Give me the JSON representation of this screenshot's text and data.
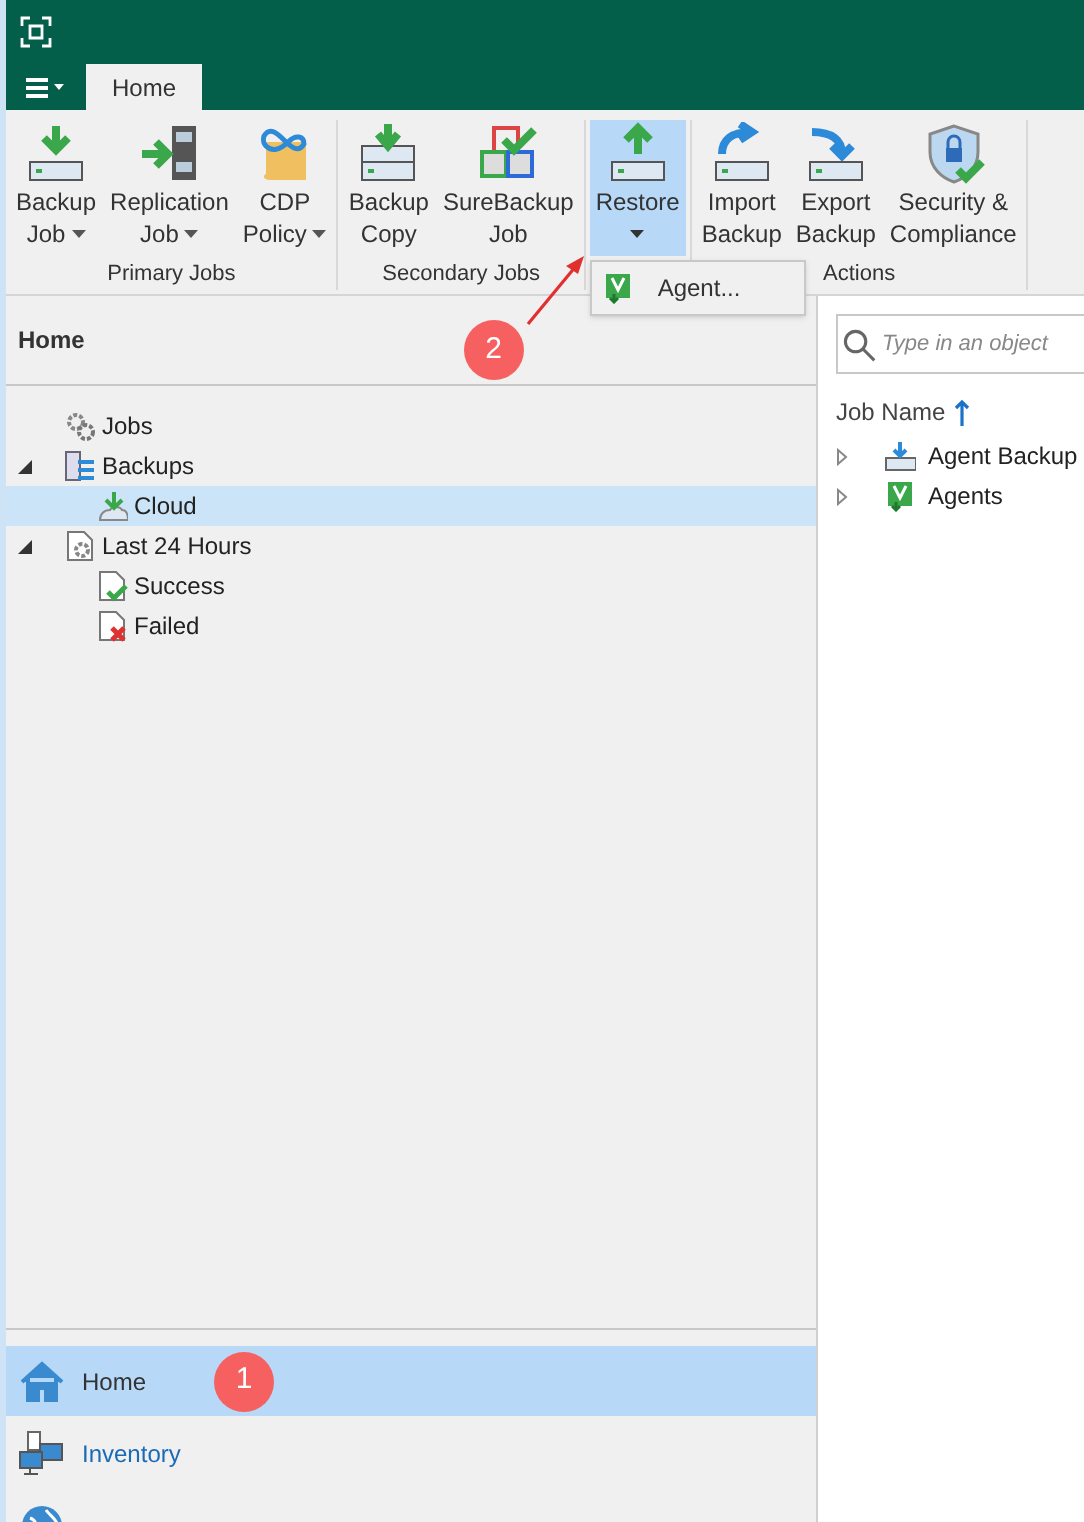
{
  "tabs": [
    {
      "label": "Home",
      "selected": true
    }
  ],
  "ribbon": [
    {
      "label": "Primary Jobs",
      "buttons": [
        {
          "lines": [
            "Backup",
            "Job"
          ],
          "kind": "backup",
          "dropdown": true,
          "selected": false
        },
        {
          "lines": [
            "Replication",
            "Job"
          ],
          "kind": "replication",
          "dropdown": true,
          "selected": false
        },
        {
          "lines": [
            "CDP",
            "Policy"
          ],
          "kind": "cdp",
          "dropdown": true,
          "selected": false
        }
      ]
    },
    {
      "label": "Secondary Jobs",
      "buttons": [
        {
          "lines": [
            "Backup",
            "Copy"
          ],
          "kind": "copy",
          "dropdown": false,
          "selected": false
        },
        {
          "lines": [
            "SureBackup",
            "Job"
          ],
          "kind": "sure",
          "dropdown": false,
          "selected": false
        }
      ]
    },
    {
      "buttons": [
        {
          "lines": [
            "Restore"
          ],
          "kind": "restore",
          "dropdown": true,
          "selected": true,
          "callout": "2",
          "menu": [
            {
              "label": "Agent..."
            }
          ]
        }
      ]
    },
    {
      "label": "Actions",
      "buttons": [
        {
          "lines": [
            "Import",
            "Backup"
          ],
          "kind": "import",
          "dropdown": false,
          "selected": false
        },
        {
          "lines": [
            "Export",
            "Backup"
          ],
          "kind": "export",
          "dropdown": false,
          "selected": false
        },
        {
          "lines": [
            "Security &",
            "Compliance"
          ],
          "kind": "security",
          "dropdown": false,
          "selected": false
        }
      ]
    }
  ],
  "left_panel": {
    "title": "Home",
    "tree": [
      {
        "label": "Jobs",
        "kind": "gears",
        "selected": false
      },
      {
        "label": "Backups",
        "kind": "backups",
        "selected": false,
        "expanded": true,
        "children": [
          {
            "label": "Cloud",
            "kind": "cloud",
            "selected": true
          }
        ]
      },
      {
        "label": "Last 24 Hours",
        "kind": "recent",
        "selected": false,
        "expanded": true,
        "children": [
          {
            "label": "Success",
            "kind": "success",
            "selected": false
          },
          {
            "label": "Failed",
            "kind": "failed",
            "selected": false
          }
        ]
      }
    ]
  },
  "navigation": [
    {
      "label": "Home",
      "kind": "home",
      "selected": true,
      "callout": "1"
    },
    {
      "label": "Inventory",
      "kind": "inventory",
      "selected": false
    },
    {
      "kind": "globe",
      "selected": false
    }
  ],
  "right_panel": {
    "search": {
      "placeholder": "Type in an object"
    },
    "column": "Job Name",
    "rows": [
      {
        "label": "Agent Backup",
        "kind": "agentbackup"
      },
      {
        "label": "Agents",
        "kind": "agents"
      }
    ]
  }
}
